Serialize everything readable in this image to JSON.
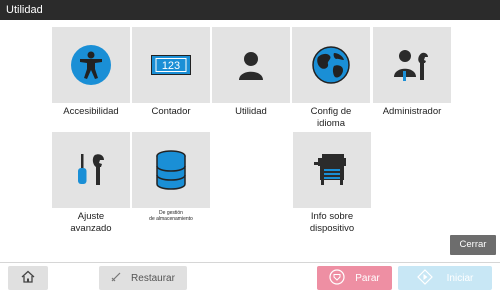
{
  "window": {
    "title": "Utilidad"
  },
  "tiles": [
    {
      "label_lines": [
        "Accesibilidad"
      ],
      "icon": "accessibility-icon"
    },
    {
      "label_lines": [
        "Contador"
      ],
      "icon": "counter-icon",
      "counter_text": "123"
    },
    {
      "label_lines": [
        "Utilidad"
      ],
      "icon": "user-icon"
    },
    {
      "label_lines": [
        "Config de",
        "idioma"
      ],
      "icon": "globe-icon"
    },
    {
      "label_lines": [
        "Administrador"
      ],
      "icon": "admin-wrench-icon"
    },
    {
      "label_lines": [
        "Ajuste",
        "avanzado"
      ],
      "icon": "screwdriver-wrench-icon"
    },
    {
      "label_lines": [
        "De gestión",
        "de almacenamiento"
      ],
      "icon": "database-icon"
    },
    {
      "label_lines": [
        "Info sobre",
        "dispositivo"
      ],
      "icon": "printer-device-icon"
    }
  ],
  "buttons": {
    "cerrar": "Cerrar",
    "restaurar": "Restaurar",
    "parar": "Parar",
    "iniciar": "Iniciar"
  },
  "icons": {
    "home": "home-icon",
    "restaurar": "reset-icon",
    "parar": "stop-icon",
    "iniciar": "start-icon"
  },
  "colors": {
    "accent_blue": "#1a8fd6",
    "tile_bg": "#e3e3e3",
    "titlebar_bg": "#2b2b2b",
    "stop_pink": "#ee8fa3",
    "start_lightblue": "#c8e7f5"
  }
}
